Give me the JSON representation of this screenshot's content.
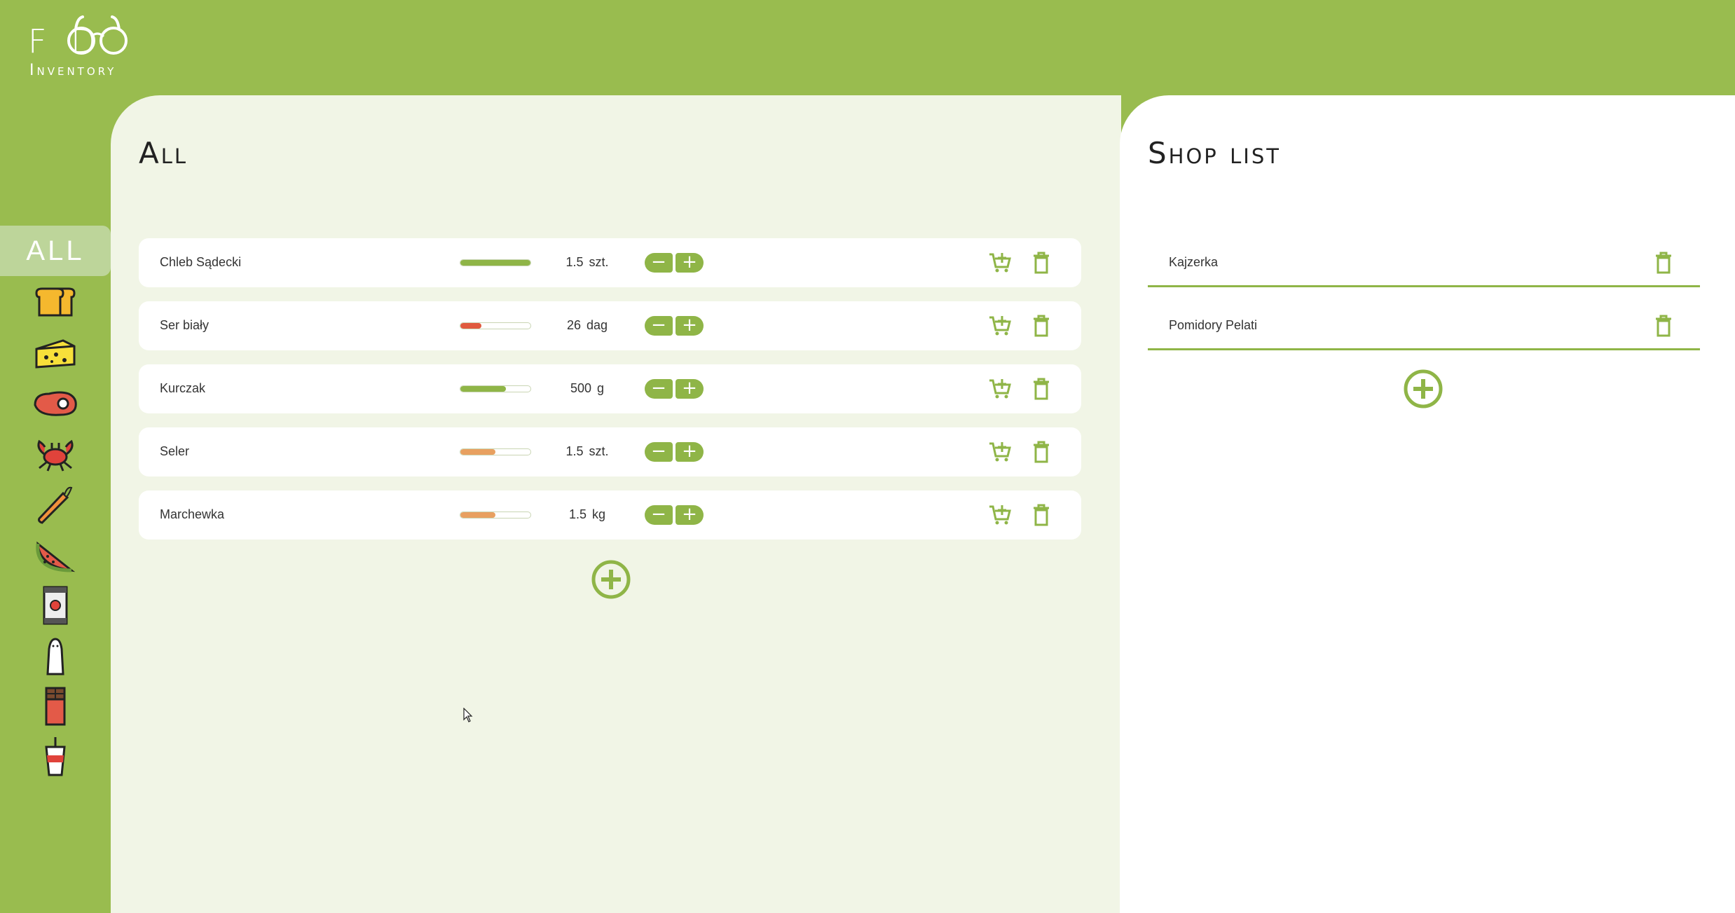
{
  "logo": {
    "word_top": "FOOD",
    "word_bottom": "Inventory",
    "food_visible": "F    D"
  },
  "sidebar": {
    "all_label": "ALL",
    "categories": [
      "bread-icon",
      "cheese-icon",
      "meat-icon",
      "crab-icon",
      "carrot-icon",
      "watermelon-icon",
      "jar-icon",
      "salt-shaker-icon",
      "chocolate-icon",
      "drink-cup-icon"
    ]
  },
  "main": {
    "title": "All",
    "items": [
      {
        "name": "Chleb Sądecki",
        "level": 1.0,
        "level_color": "#8fb547",
        "amount": "1.5",
        "unit": "szt."
      },
      {
        "name": "Ser biały",
        "level": 0.3,
        "level_color": "#e05a3d",
        "amount": "26",
        "unit": "dag"
      },
      {
        "name": "Kurczak",
        "level": 0.65,
        "level_color": "#8fb547",
        "amount": "500",
        "unit": "g"
      },
      {
        "name": "Seler",
        "level": 0.5,
        "level_color": "#e8a060",
        "amount": "1.5",
        "unit": "szt."
      },
      {
        "name": "Marchewka",
        "level": 0.5,
        "level_color": "#e8a060",
        "amount": "1.5",
        "unit": "kg"
      }
    ],
    "minus_label": "−",
    "plus_label": "+"
  },
  "shop": {
    "title": "Shop list",
    "items": [
      {
        "name": "Kajzerka"
      },
      {
        "name": "Pomidory Pelati"
      }
    ]
  },
  "colors": {
    "brand_green": "#99bc4f",
    "button_green": "#8fb547",
    "panel_bg": "#f1f5e6"
  }
}
